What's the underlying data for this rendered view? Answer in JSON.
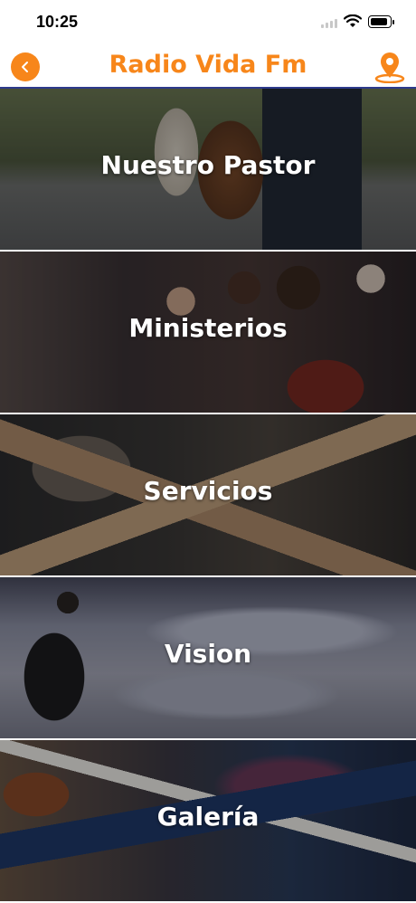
{
  "status_bar": {
    "time": "10:25"
  },
  "nav": {
    "title": "Radio Vida Fm",
    "accent_color": "#f7861a",
    "back_icon": "chevron-left-icon",
    "location_icon": "map-pin-icon"
  },
  "menu": {
    "items": [
      {
        "label": "Nuestro Pastor"
      },
      {
        "label": "Ministerios"
      },
      {
        "label": "Servicios"
      },
      {
        "label": "Vision"
      },
      {
        "label": "Galería"
      }
    ]
  }
}
